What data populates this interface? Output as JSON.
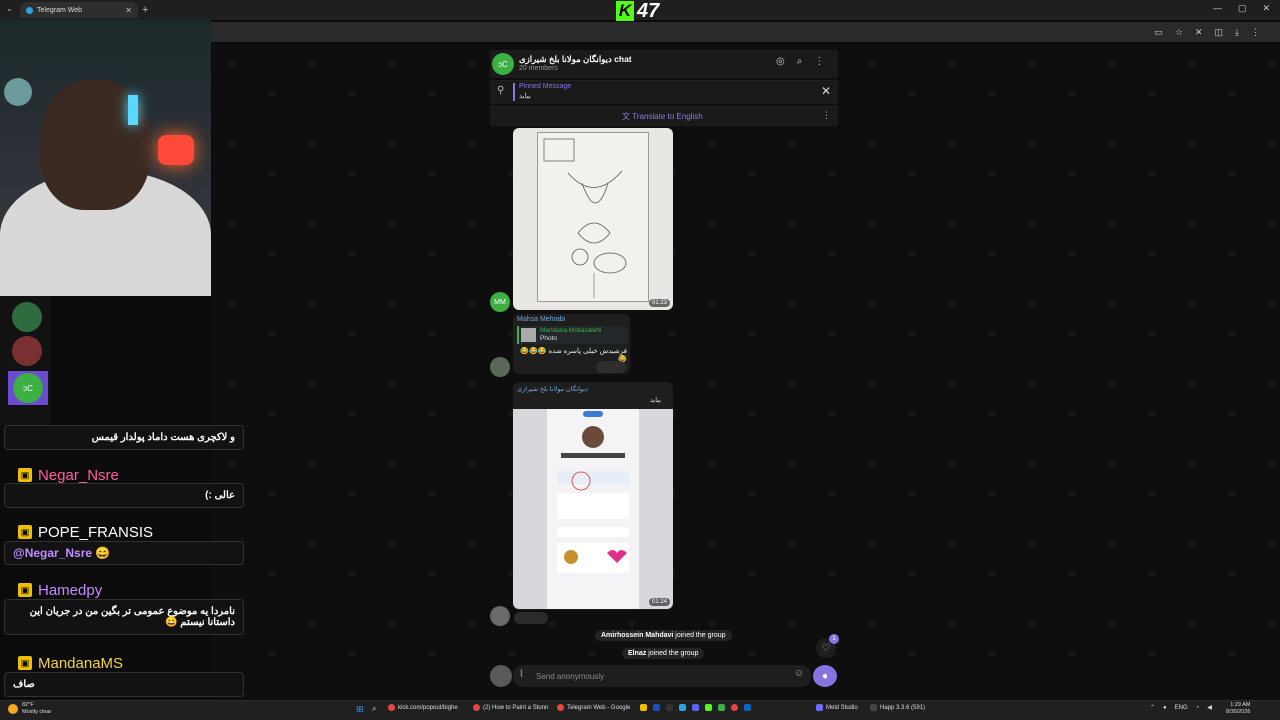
{
  "browser": {
    "tab_title": "Telegram Web",
    "new_tab": "+",
    "menu_arrow": "⌄",
    "win_controls": [
      "—",
      "▢",
      "✕"
    ],
    "close_tab": "✕"
  },
  "stream": {
    "logo_k": "K",
    "logo_number": "47",
    "sidebar_selected_initials": "ɔC",
    "chat": [
      {
        "type": "text",
        "text": "و لاکچری هست داماد پولدار قیمس"
      },
      {
        "type": "name",
        "name": "Negar_Nsre",
        "color": "#ff5fa2"
      },
      {
        "type": "text",
        "text": "عالی :)"
      },
      {
        "type": "name",
        "name": "POPE_FRANSIS",
        "color": "#ffffff"
      },
      {
        "type": "text",
        "text": "@Negar_Nsre 😄"
      },
      {
        "type": "name",
        "name": "Hamedpy",
        "color": "#c38cff"
      },
      {
        "type": "text",
        "text": "نامردا یه موضوع عمومی تر بگین من در جریان این داستانا نیستم 😄"
      },
      {
        "type": "name",
        "name": "MandanaMS",
        "color": "#f5d04a"
      },
      {
        "type": "text",
        "text": "صاف"
      }
    ]
  },
  "telegram": {
    "header": {
      "avatar_initials": "ɔC",
      "title": "دیوانگان مولانا بلخ شیرازی chat",
      "members": "20 members"
    },
    "pinned": {
      "label": "Pinned Message",
      "text": "بیاید"
    },
    "translate_label": "Translate to English",
    "messages": {
      "photo1_time": "01:23",
      "avatar1_initials": "MM",
      "msg2_sender": "Mahsa Mehrabi",
      "msg2_reply_name": "Mandana Mollasalehi",
      "msg2_reply_type": "Photo",
      "msg2_text": "فرشیدش خیلی پاسره شده 😂😂😂😂",
      "msg3_forward": "دیوانگان مولانا بلخ شیرازی",
      "msg3_text": "بیاید",
      "photo2_time": "01:24"
    },
    "service": [
      {
        "name": "Amirhossein Mahdavi",
        "action": " joined the group"
      },
      {
        "name": "Elnaz",
        "action": " joined the group"
      }
    ],
    "unread_count": "1",
    "composer_placeholder": "Send anonymously"
  },
  "taskbar": {
    "weather_temp": "82°F",
    "weather_desc": "Mostly clear",
    "apps": [
      "kick.com/popout/bighe",
      "(2) How to Paint a Stunn",
      "Telegram Web - Google",
      "Meld Studio",
      "Happ 3.3.6 (591)"
    ],
    "language": "ENG",
    "time": "1:29 AM",
    "date": "8/30/2026"
  },
  "colors": {
    "accent": "#8774e1",
    "kick_green": "#53fc18",
    "telegram_green": "#3cb043"
  }
}
